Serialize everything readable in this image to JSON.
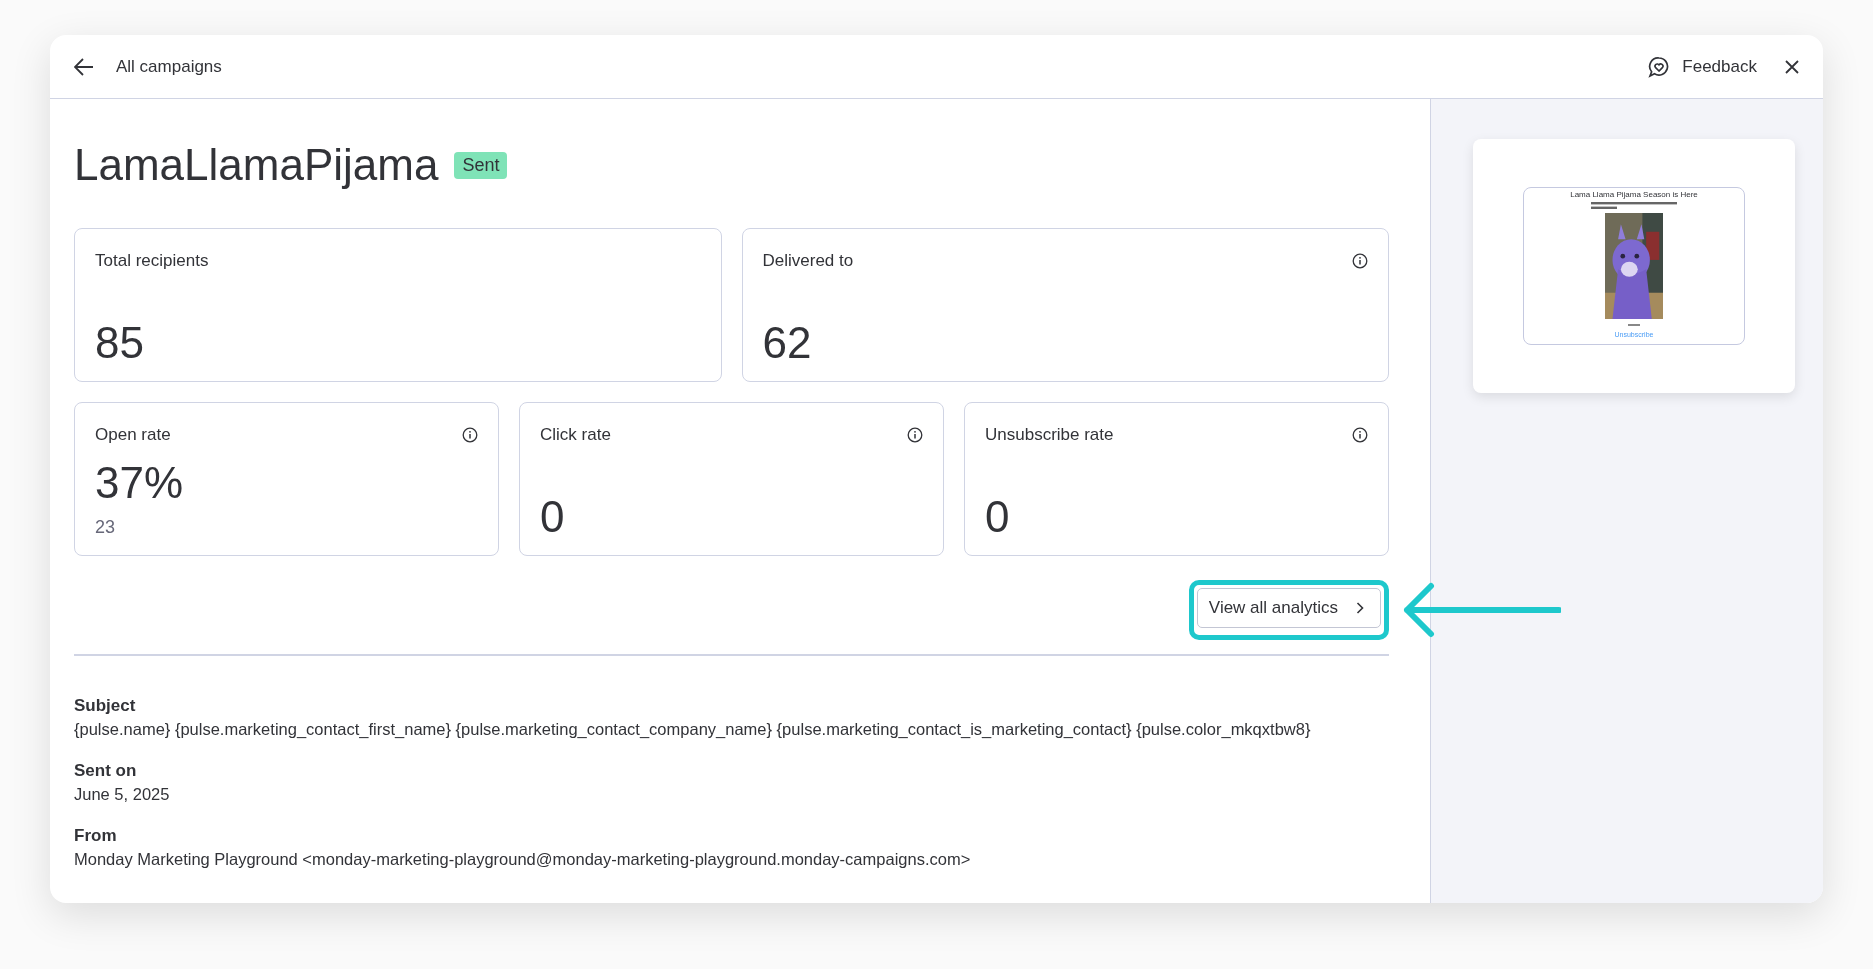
{
  "header": {
    "back_label": "All campaigns",
    "feedback_label": "Feedback"
  },
  "campaign": {
    "title": "LamaLlamaPijama",
    "status": "Sent"
  },
  "stats_top": [
    {
      "label": "Total recipients",
      "value": "85",
      "info": false
    },
    {
      "label": "Delivered to",
      "value": "62",
      "info": true
    }
  ],
  "stats_bottom": [
    {
      "label": "Open rate",
      "value": "37%",
      "sub": "23",
      "info": true
    },
    {
      "label": "Click rate",
      "value": "0",
      "info": true
    },
    {
      "label": "Unsubscribe rate",
      "value": "0",
      "info": true
    }
  ],
  "analytics_button": {
    "label": "View all analytics",
    "highlighted": true
  },
  "details": [
    {
      "label": "Subject",
      "value": "{pulse.name} {pulse.marketing_contact_first_name} {pulse.marketing_contact_company_name} {pulse.marketing_contact_is_marketing_contact} {pulse.color_mkqxtbw8}"
    },
    {
      "label": "Sent on",
      "value": "June 5, 2025"
    },
    {
      "label": "From",
      "value": "Monday Marketing Playground <monday-marketing-playground@monday-marketing-playground.monday-campaigns.com>"
    }
  ],
  "preview": {
    "heading": "Lama Llama Pijama Season is Here",
    "link": "Unsubscribe"
  }
}
